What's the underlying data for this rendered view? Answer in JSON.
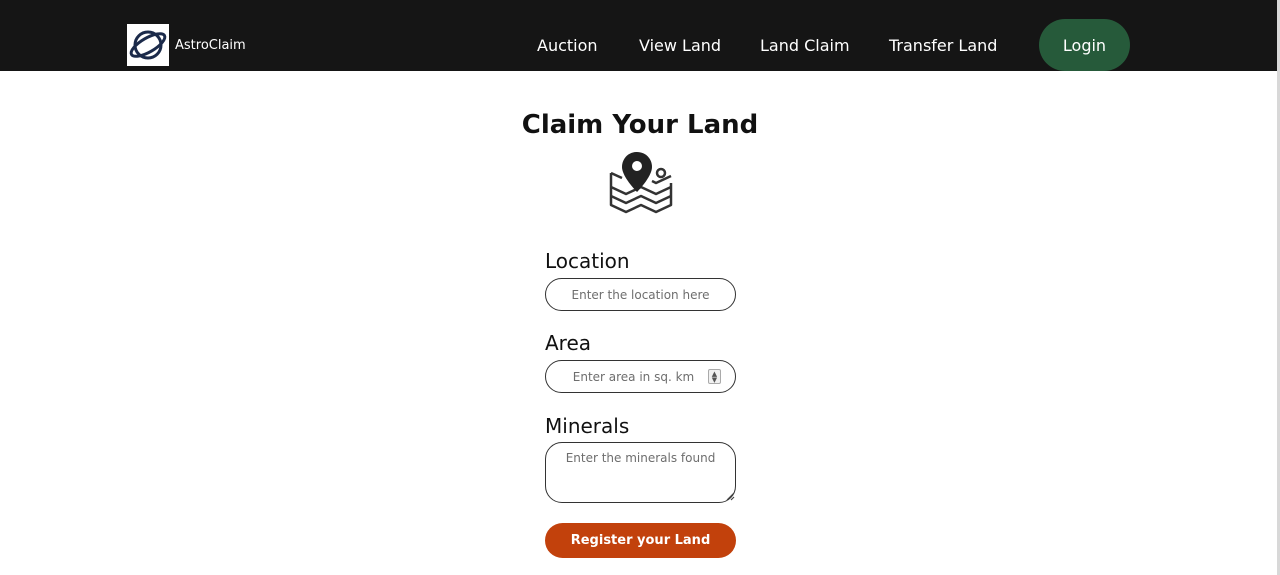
{
  "brand": {
    "name": "AstroClaim",
    "logo_icon": "planet-icon"
  },
  "nav": {
    "links": [
      {
        "label": "Auction"
      },
      {
        "label": "View Land"
      },
      {
        "label": "Land Claim"
      },
      {
        "label": "Transfer Land"
      }
    ],
    "login_label": "Login"
  },
  "page": {
    "title": "Claim Your Land",
    "hero_icon": "map-pin-icon"
  },
  "form": {
    "location": {
      "label": "Location",
      "placeholder": "Enter the location here",
      "value": ""
    },
    "area": {
      "label": "Area",
      "placeholder": "Enter area in sq. km",
      "value": ""
    },
    "minerals": {
      "label": "Minerals",
      "placeholder": "Enter the minerals found",
      "value": ""
    },
    "submit_label": "Register your Land"
  },
  "colors": {
    "navbar": "#151515",
    "login_button": "#265a3a",
    "submit_button": "#c2410c"
  }
}
